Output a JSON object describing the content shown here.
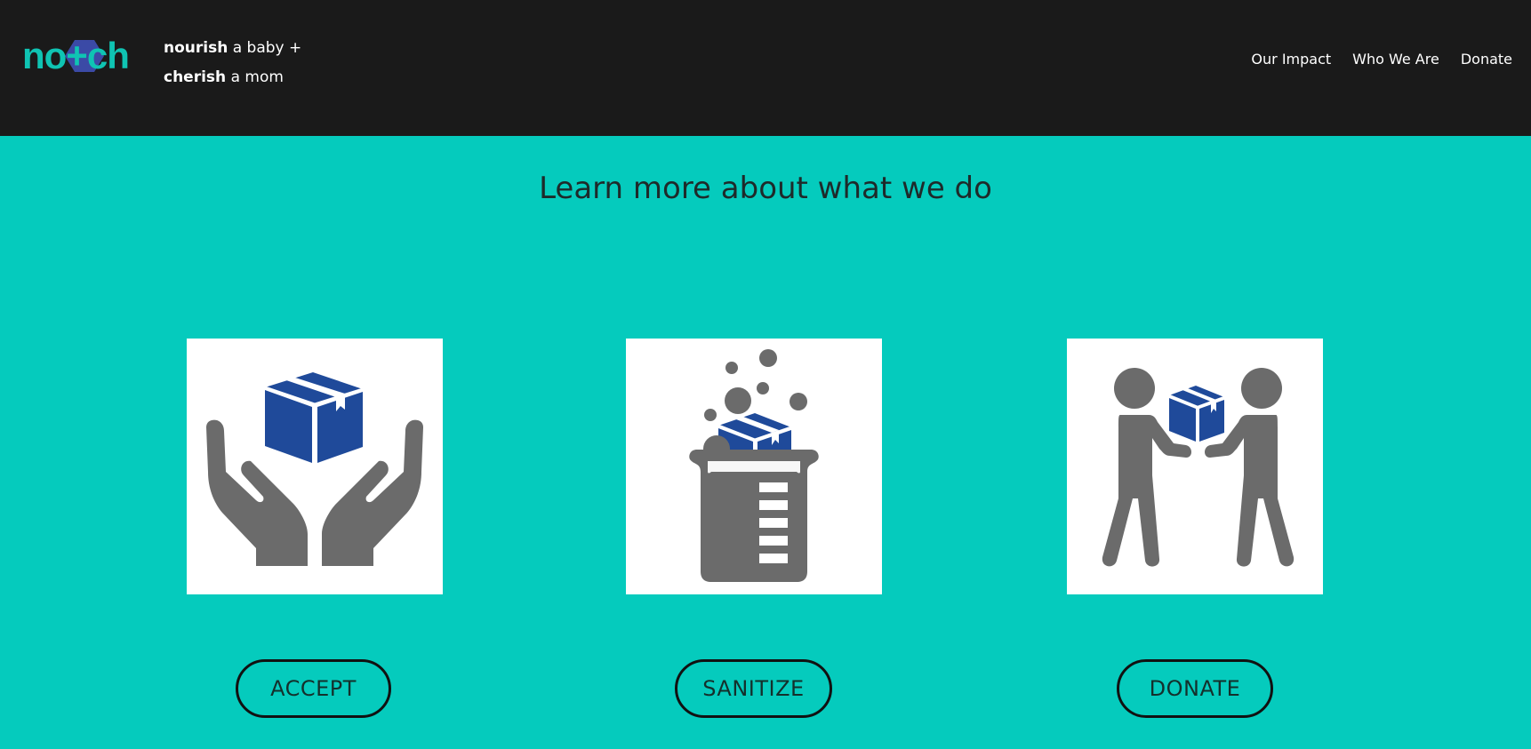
{
  "brand": {
    "logo_text": "no+ch",
    "tagline_line1_bold": "nourish",
    "tagline_line1_rest": "a baby +",
    "tagline_line2_bold": "cherish",
    "tagline_line2_rest": "a mom"
  },
  "nav": {
    "items": [
      {
        "label": "Our Impact"
      },
      {
        "label": "Who We Are"
      },
      {
        "label": "Donate"
      }
    ]
  },
  "main": {
    "heading": "Learn more about what we do",
    "steps": [
      {
        "label": "ACCEPT",
        "icon": "hands-holding-box-icon"
      },
      {
        "label": "SANITIZE",
        "icon": "beaker-with-box-icon"
      },
      {
        "label": "DONATE",
        "icon": "people-handing-box-icon"
      }
    ]
  },
  "colors": {
    "background": "#05cbbd",
    "header": "#1a1a1a",
    "brand_teal": "#0fc4b3",
    "icon_gray": "#6b6b6b",
    "icon_blue": "#1f4a9a"
  }
}
